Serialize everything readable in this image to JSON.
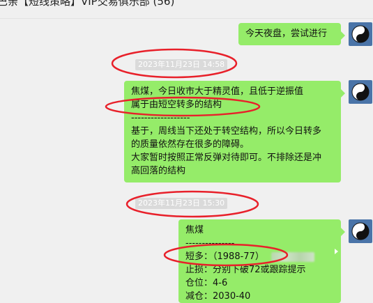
{
  "window": {
    "title": "巴亲【短线策略】VIP交易俱乐部 (56)"
  },
  "messages": {
    "msg1": {
      "text": "今天夜盘，尝试进行"
    },
    "ts1": "2023年11月23日 14:58",
    "msg2": {
      "line1": "焦煤，今日收市大于精灵值，且低于逆振值",
      "line2": "属于由短空转多的结构",
      "line3": "------------------",
      "line4": "基于，周线当下还处于转空结构，所以今日转多",
      "line5": "的质量依然存在很多的障碍。",
      "line6": "大家暂时按照正常反弹对待即可。不排除还是冲",
      "line7": "高回落的结构"
    },
    "ts2": "2023年11月23日 15:30",
    "msg3": {
      "line1": "焦煤",
      "line2": "---------------",
      "line3": "短多：（1988-77）",
      "line4": "止损：分别下破72或跟踪提示",
      "line5": "仓位：4-6",
      "line6": "减仓：2030-40"
    }
  },
  "colors": {
    "bubble": "#95ec69",
    "annotation": "#e8202a",
    "timestamp_bg": "#dadada",
    "avatar_bg": "#4a74a8"
  },
  "icons": {
    "avatar": "yin-yang-icon"
  }
}
